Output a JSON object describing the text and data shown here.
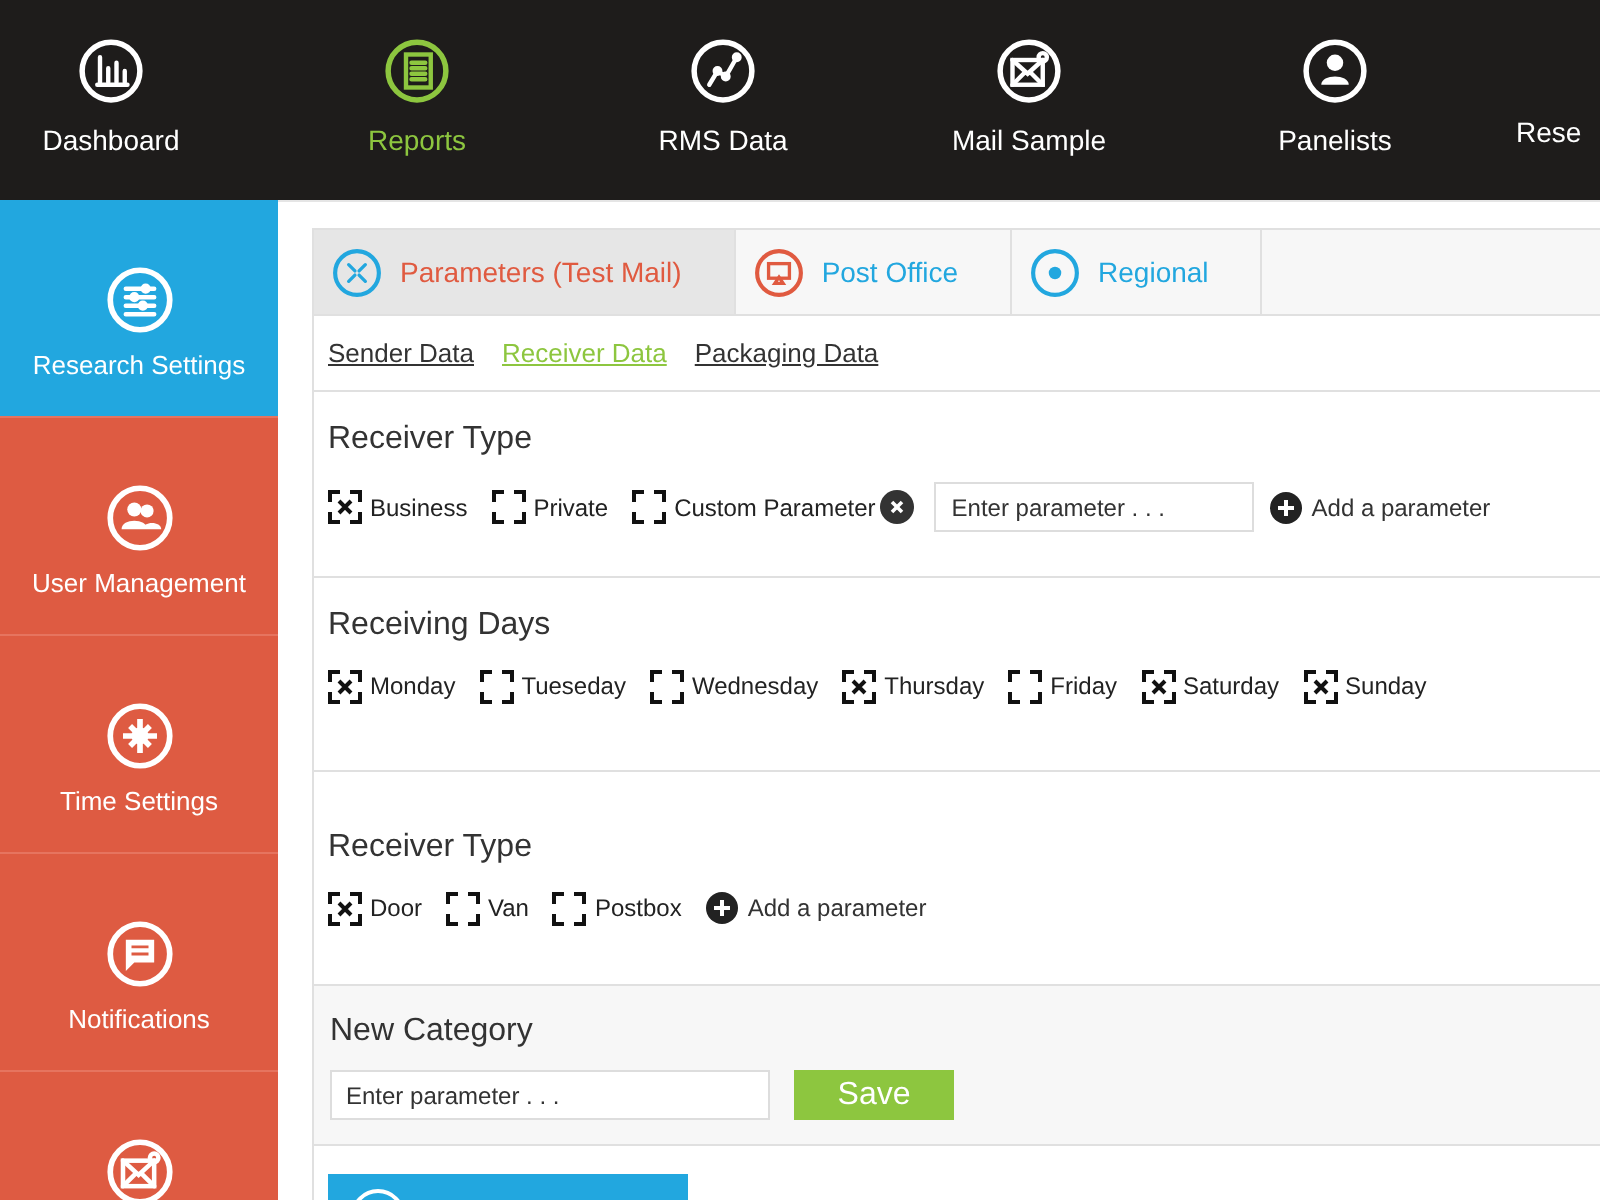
{
  "top_nav": [
    {
      "label": "Dashboard",
      "selected": false
    },
    {
      "label": "Reports",
      "selected": true
    },
    {
      "label": "RMS Data",
      "selected": false
    },
    {
      "label": "Mail Sample",
      "selected": false
    },
    {
      "label": "Panelists",
      "selected": false
    },
    {
      "label": "Rese",
      "selected": false
    }
  ],
  "sidebar": [
    {
      "label": "Research Settings",
      "selected": true
    },
    {
      "label": "User Management",
      "selected": false
    },
    {
      "label": "Time Settings",
      "selected": false
    },
    {
      "label": "Notifications",
      "selected": false
    },
    {
      "selected": false
    }
  ],
  "tabs": [
    {
      "label": "Parameters (Test Mail)",
      "selected": true
    },
    {
      "label": "Post Office",
      "selected": false
    },
    {
      "label": "Regional",
      "selected": false
    }
  ],
  "sub_tabs": [
    {
      "label": "Sender Data",
      "selected": false
    },
    {
      "label": "Receiver Data",
      "selected": true
    },
    {
      "label": "Packaging Data",
      "selected": false
    }
  ],
  "sections": [
    {
      "title": "Receiver Type",
      "items": [
        {
          "kind": "checkbox",
          "label": "Business",
          "checked": true
        },
        {
          "kind": "checkbox",
          "label": "Private",
          "checked": false
        },
        {
          "kind": "checkbox",
          "label": "Custom Parameter",
          "checked": false
        },
        {
          "kind": "remove"
        },
        {
          "kind": "input",
          "placeholder": "Enter parameter . . ."
        },
        {
          "kind": "add",
          "label": "Add a parameter"
        }
      ]
    },
    {
      "title": "Receiving Days",
      "items": [
        {
          "kind": "checkbox",
          "label": "Monday",
          "checked": true
        },
        {
          "kind": "checkbox",
          "label": "Tueseday",
          "checked": false
        },
        {
          "kind": "checkbox",
          "label": "Wednesday",
          "checked": false
        },
        {
          "kind": "checkbox",
          "label": "Thursday",
          "checked": true
        },
        {
          "kind": "checkbox",
          "label": "Friday",
          "checked": false
        },
        {
          "kind": "checkbox",
          "label": "Saturday",
          "checked": true
        },
        {
          "kind": "checkbox",
          "label": "Sunday",
          "checked": true
        }
      ]
    },
    {
      "title": "Receiver Type",
      "items": [
        {
          "kind": "checkbox",
          "label": "Door",
          "checked": true
        },
        {
          "kind": "checkbox",
          "label": "Van",
          "checked": false
        },
        {
          "kind": "checkbox",
          "label": "Postbox",
          "checked": false
        },
        {
          "kind": "add",
          "label": "Add a parameter"
        }
      ]
    }
  ],
  "new_category": {
    "title": "New Category",
    "placeholder": "Enter parameter . . .",
    "button": "Save"
  }
}
